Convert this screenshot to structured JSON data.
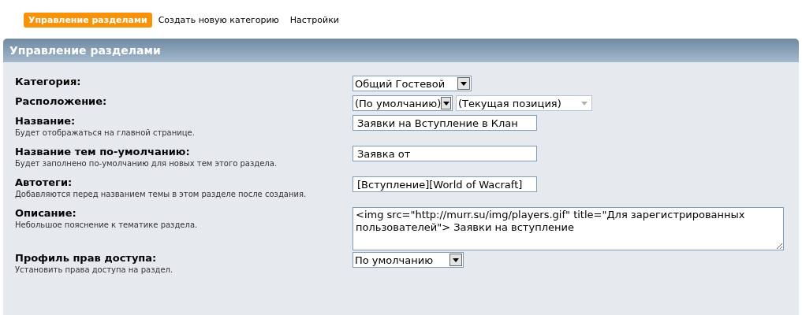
{
  "tabs": [
    {
      "label": "Управление разделами",
      "selected": true
    },
    {
      "label": "Создать новую категорию",
      "selected": false
    },
    {
      "label": "Настройки",
      "selected": false
    }
  ],
  "panel": {
    "title": "Управление разделами"
  },
  "fields": [
    {
      "label": "Категория:",
      "controls": [
        {
          "kind": "select",
          "value": "Общий Гостевой",
          "disabled": false
        }
      ]
    },
    {
      "label": "Расположение:",
      "controls": [
        {
          "kind": "select",
          "value": "(По умолчанию)",
          "disabled": false
        },
        {
          "kind": "select",
          "value": "(Текущая позиция)",
          "disabled": true
        }
      ]
    },
    {
      "label": "Название:",
      "hint": "Будет отображаться на главной странице.",
      "controls": [
        {
          "kind": "text",
          "value": "Заявки на Вступление в Клан"
        }
      ]
    },
    {
      "label": "Название тем по-умолчанию:",
      "hint": "Будет заполнено по-умолчанию для новых тем этого раздела.",
      "controls": [
        {
          "kind": "text",
          "value": "Заявка от"
        }
      ]
    },
    {
      "label": "Автотеги:",
      "hint": "Добавляются перед названием темы в этом разделе после создания.",
      "controls": [
        {
          "kind": "text",
          "value": "[Вступление][World of Wacraft]"
        }
      ]
    },
    {
      "label": "Описание:",
      "hint": "Небольшое пояснение к тематике раздела.",
      "controls": [
        {
          "kind": "textarea",
          "value": "<img src=\"http://murr.su/img/players.gif\" title=\"Для зарегистрированных пользователей\"> Заявки на вступление"
        }
      ]
    },
    {
      "label": "Профиль прав доступа:",
      "hint": "Установить права доступа на раздел.",
      "controls": [
        {
          "kind": "select",
          "value": "По умолчанию",
          "disabled": false
        }
      ]
    }
  ]
}
